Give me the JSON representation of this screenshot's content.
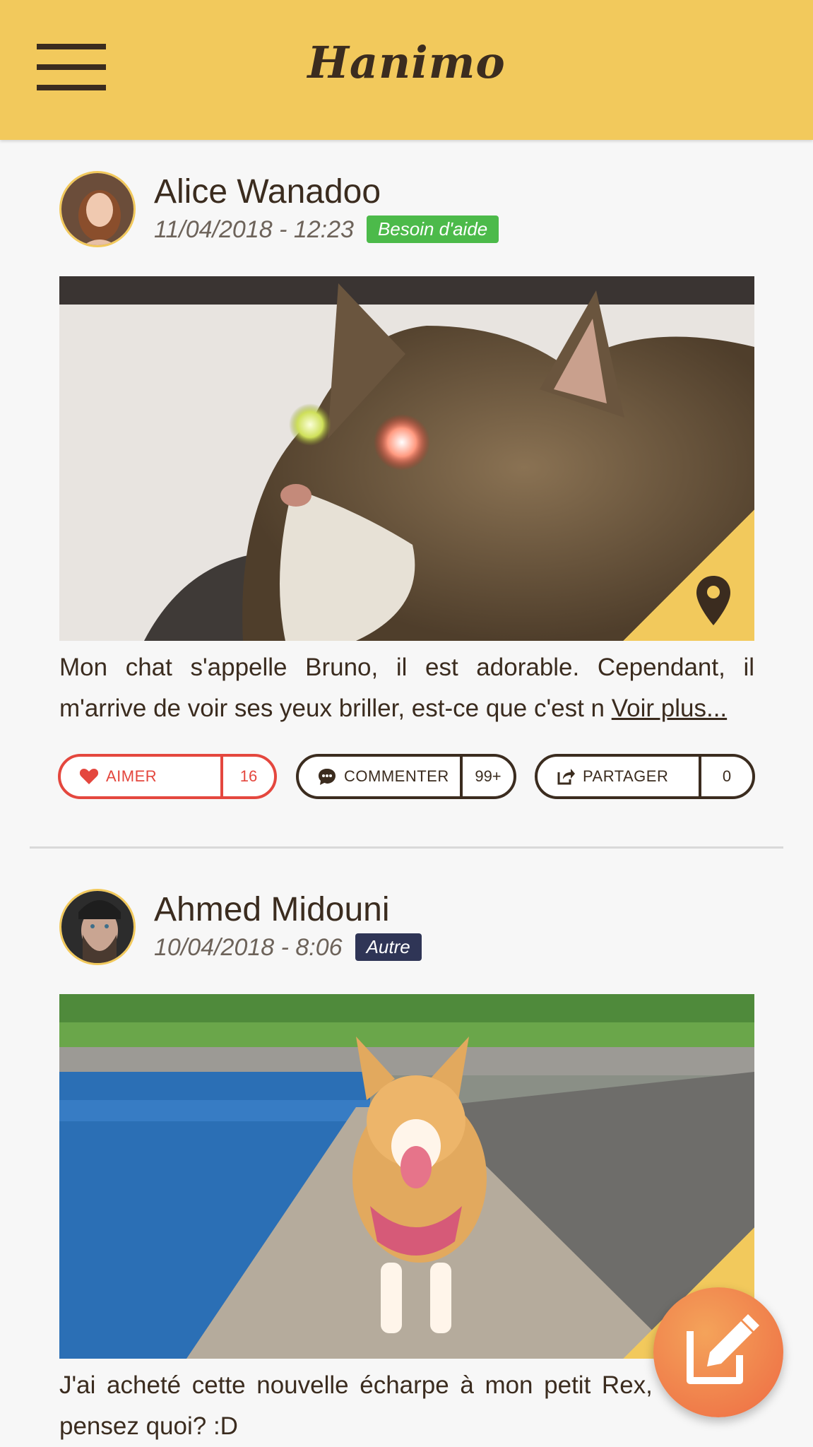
{
  "app": {
    "title": "Hanimo",
    "accent": "#f2c95c",
    "text_color": "#3b2c1f",
    "menu_icon": "hamburger-icon"
  },
  "posts": [
    {
      "author": "Alice Wanadoo",
      "datetime": "11/04/2018 - 12:23",
      "badge": {
        "label": "Besoin d'aide",
        "color": "#4cba4a"
      },
      "image": "cat-photo",
      "location_icon": "map-pin-icon",
      "text": "Mon chat s'appelle Bruno, il est adorable. Cependant,  il m'arrive de voir ses yeux briller, est-ce que c'est n",
      "more_label": "Voir plus...",
      "actions": {
        "like": {
          "label": "AIMER",
          "count": "16",
          "icon": "heart-icon"
        },
        "comment": {
          "label": "COMMENTER",
          "count": "99+",
          "icon": "comment-icon"
        },
        "share": {
          "label": "PARTAGER",
          "count": "0",
          "icon": "share-icon"
        }
      }
    },
    {
      "author": "Ahmed Midouni",
      "datetime": "10/04/2018 - 8:06",
      "badge": {
        "label": "Autre",
        "color": "#2f3556"
      },
      "image": "corgi-photo",
      "text": "J'ai acheté cette nouvelle écharpe à mon petit Rex, vous en pensez quoi? :D"
    }
  ],
  "fab": {
    "icon": "edit-icon"
  }
}
